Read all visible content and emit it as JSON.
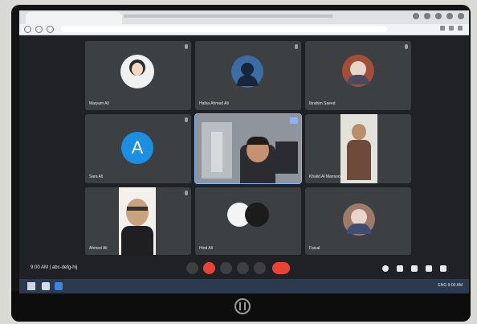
{
  "browser": {
    "tab_title": "",
    "url": ""
  },
  "participants": [
    {
      "name": "Maryam Ali",
      "kind": "avatar",
      "color": "#f1f1f1"
    },
    {
      "name": "Hafsa Ahmed Ali",
      "kind": "avatar",
      "color": "#3a6ea5"
    },
    {
      "name": "Ibrahim Saeed",
      "kind": "avatar",
      "color": "#a34e38"
    },
    {
      "name": "Sara Ali",
      "kind": "letter",
      "letter": "A",
      "color": "#1a8fe3"
    },
    {
      "name": "",
      "kind": "video-main",
      "color": "#6f7680"
    },
    {
      "name": "Khalid Al Mansoori",
      "kind": "photo",
      "color": "#b88f6a"
    },
    {
      "name": "Ahmed Ali",
      "kind": "photo",
      "color": "#c9a27f"
    },
    {
      "name": "Hind Ali",
      "kind": "avatar",
      "color": "#1c1c1c"
    },
    {
      "name": "Faisal",
      "kind": "avatar",
      "color": "#a07a68"
    }
  ],
  "meeting": {
    "info": "9:00 AM | abc-defg-hij"
  },
  "taskbar": {
    "tray_text": "ENG  9:00 AM"
  }
}
